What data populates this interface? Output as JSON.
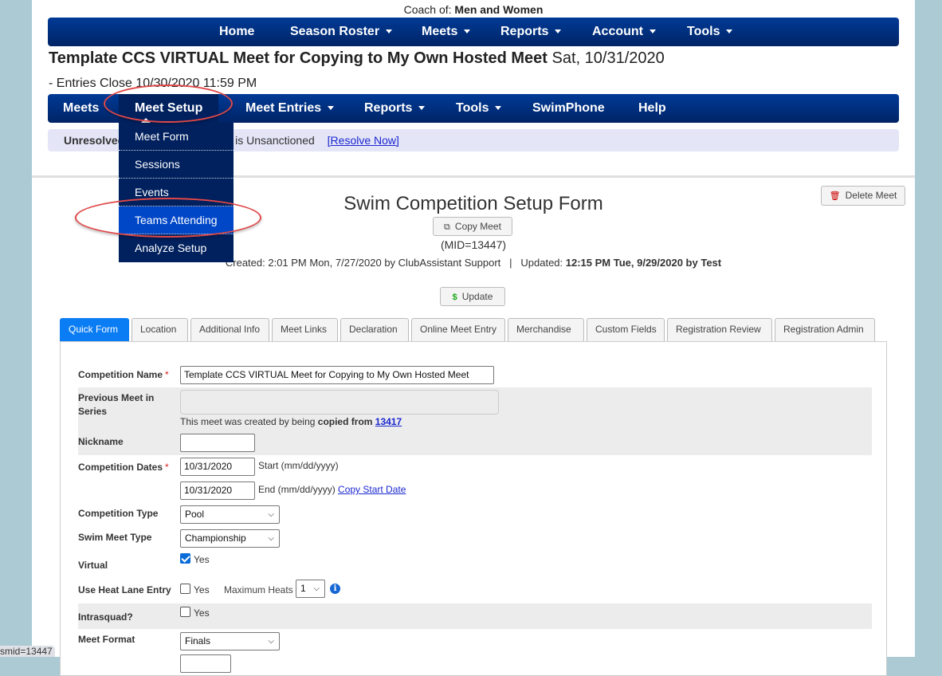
{
  "header": {
    "coach_prefix": "Coach of:",
    "coach_value": "Men and Women"
  },
  "top_nav": [
    {
      "label": "Home",
      "dropdown": false
    },
    {
      "label": "Season Roster",
      "dropdown": true
    },
    {
      "label": "Meets",
      "dropdown": true
    },
    {
      "label": "Reports",
      "dropdown": true
    },
    {
      "label": "Account",
      "dropdown": true
    },
    {
      "label": "Tools",
      "dropdown": true
    }
  ],
  "meet": {
    "title": "Template CCS VIRTUAL Meet for Copying to My Own Hosted Meet",
    "date": "Sat, 10/31/2020",
    "entries_close": "- Entries Close 10/30/2020 11:59 PM"
  },
  "meet_nav": [
    {
      "label": "Meets",
      "dropdown": false
    },
    {
      "label": "Meet Setup",
      "dropdown": false,
      "active": true
    },
    {
      "label": "Meet Entries",
      "dropdown": true
    },
    {
      "label": "Reports",
      "dropdown": true
    },
    {
      "label": "Tools",
      "dropdown": true
    },
    {
      "label": "SwimPhone",
      "dropdown": false
    },
    {
      "label": "Help",
      "dropdown": false
    }
  ],
  "meet_setup_menu": [
    {
      "label": "Meet Form"
    },
    {
      "label": "Sessions"
    },
    {
      "label": "Events"
    },
    {
      "label": "Teams Attending",
      "highlighted": true
    },
    {
      "label": "Analyze Setup"
    }
  ],
  "alert": {
    "label": "Unresolved",
    "message": "Meet is Unsanctioned",
    "link": "[Resolve Now]"
  },
  "form": {
    "title": "Swim Competition Setup Form",
    "copy_button": "Copy Meet",
    "mid": "(MID=13447)",
    "created": "Created: 2:01 PM Mon, 7/27/2020 by ClubAssistant Support",
    "separator": "|",
    "updated_prefix": "Updated:",
    "updated_value": "12:15 PM Tue, 9/29/2020 by Test",
    "update_button": "Update",
    "delete_button": "Delete Meet"
  },
  "tabs": [
    {
      "label": "Quick Form",
      "active": true
    },
    {
      "label": "Location"
    },
    {
      "label": "Additional Info"
    },
    {
      "label": "Meet Links"
    },
    {
      "label": "Declaration"
    },
    {
      "label": "Online Meet Entry"
    },
    {
      "label": "Merchandise"
    },
    {
      "label": "Custom Fields"
    },
    {
      "label": "Registration Review"
    },
    {
      "label": "Registration Admin"
    }
  ],
  "fields": {
    "competition_name": {
      "label": "Competition Name",
      "required": "*",
      "value": "Template CCS VIRTUAL Meet for Copying to My Own Hosted Meet"
    },
    "previous_meet": {
      "label_line1": "Previous Meet in",
      "label_line2": "Series",
      "value": "",
      "note_prefix": "This meet was created by being",
      "note_bold": "copied from",
      "note_link": "13417"
    },
    "nickname": {
      "label": "Nickname",
      "value": ""
    },
    "competition_dates": {
      "label": "Competition Dates",
      "required": "*",
      "start_value": "10/31/2020",
      "start_hint": "Start (mm/dd/yyyy)",
      "end_value": "10/31/2020",
      "end_hint": "End (mm/dd/yyyy)",
      "copy_link": "Copy Start Date"
    },
    "competition_type": {
      "label": "Competition Type",
      "value": "Pool"
    },
    "swim_meet_type": {
      "label": "Swim Meet Type",
      "value": "Championship"
    },
    "virtual": {
      "label": "Virtual",
      "checked": true,
      "option": "Yes"
    },
    "heat_lane_entry": {
      "label": "Use Heat Lane Entry",
      "checked": false,
      "option": "Yes",
      "max_heats_label": "Maximum Heats",
      "max_heats_value": "1"
    },
    "intrasquad": {
      "label": "Intrasquad?",
      "checked": false,
      "option": "Yes"
    },
    "meet_format": {
      "label": "Meet Format",
      "value": "Finals"
    }
  },
  "status_bar": {
    "text": "smid=13447"
  },
  "colors": {
    "nav_blue": "#003a96",
    "menu_dark": "#00205e",
    "menu_highlight": "#0047c8",
    "active_tab": "#0a7cf4",
    "alert_bg": "#e4e5f7",
    "annotation_red": "#e04848",
    "background": "#abcad3"
  }
}
